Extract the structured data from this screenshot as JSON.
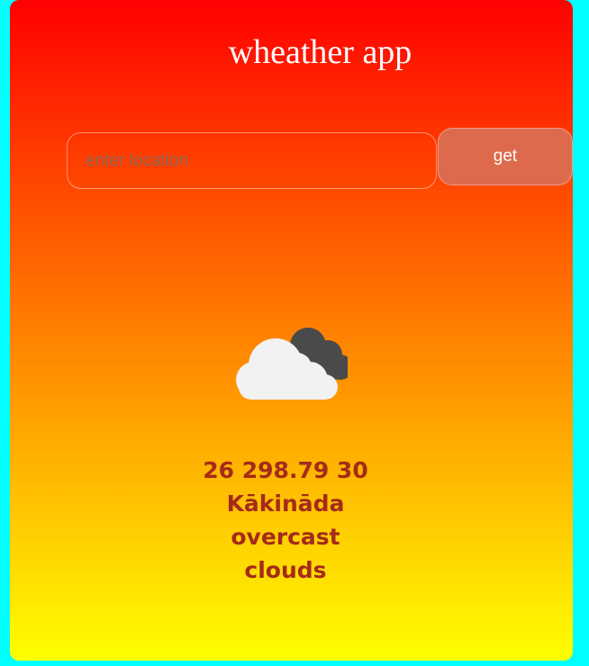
{
  "app": {
    "title": "wheather app"
  },
  "search": {
    "placeholder": "enter location",
    "value": "",
    "button_label": "get"
  },
  "weather": {
    "icon": "overcast-clouds-icon",
    "values_line": "26 298.79 30",
    "city": "Kākināda",
    "description_line1": "overcast",
    "description_line2": "clouds"
  },
  "colors": {
    "page_background": "#00ffff",
    "gradient_top": "#ff0000",
    "gradient_bottom": "#ffff00",
    "button_background": "#de6a4d",
    "info_text": "#a52a1a"
  }
}
